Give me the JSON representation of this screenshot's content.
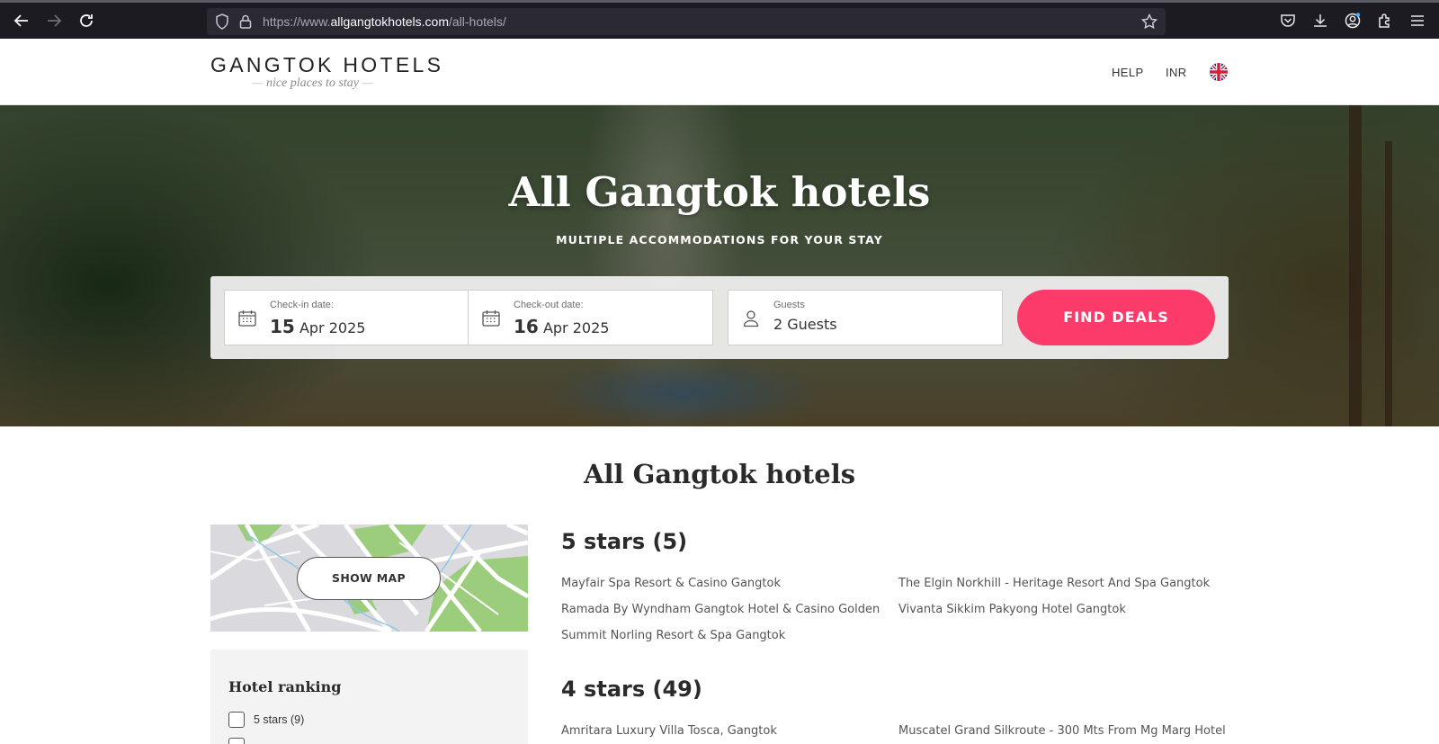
{
  "browser": {
    "url_prefix": "https://www.",
    "url_domain": "allgangtokhotels.com",
    "url_path": "/all-hotels/"
  },
  "header": {
    "logo_title": "GANGTOK HOTELS",
    "logo_tagline": "nice places to stay",
    "logo_dash": "—",
    "help_label": "HELP",
    "currency_label": "INR"
  },
  "hero": {
    "title": "All Gangtok hotels",
    "subtitle": "MULTIPLE ACCOMMODATIONS FOR YOUR STAY"
  },
  "search": {
    "checkin_label": "Check-in date:",
    "checkin_day": "15",
    "checkin_month_year": "Apr 2025",
    "checkout_label": "Check-out date:",
    "checkout_day": "16",
    "checkout_month_year": "Apr 2025",
    "guests_label": "Guests",
    "guests_value": "2 Guests",
    "find_label": "FIND DEALS"
  },
  "main": {
    "title": "All Gangtok hotels",
    "show_map_label": "SHOW MAP"
  },
  "filters": {
    "title": "Hotel ranking",
    "items": [
      {
        "label": "5 stars (9)"
      }
    ]
  },
  "categories": [
    {
      "title": "5 stars (5)",
      "hotels": [
        "Mayfair Spa Resort & Casino Gangtok",
        "The Elgin Norkhill - Heritage Resort And Spa Gangtok",
        "Ramada By Wyndham Gangtok Hotel & Casino Golden",
        "Vivanta Sikkim Pakyong Hotel Gangtok",
        "Summit Norling Resort & Spa Gangtok"
      ]
    },
    {
      "title": "4 stars (49)",
      "hotels": [
        "Amritara Luxury Villa Tosca, Gangtok",
        "Muscatel Grand Silkroute - 300 Mts From Mg Marg Hotel"
      ]
    }
  ],
  "colors": {
    "accent": "#fd3b6a",
    "browser_bg": "#1c1b22"
  },
  "icons": {
    "back": "arrow-left-icon",
    "forward": "arrow-right-icon",
    "reload": "reload-icon",
    "calendar": "calendar-icon",
    "guests": "user-icon",
    "flag": "uk-flag-icon"
  }
}
